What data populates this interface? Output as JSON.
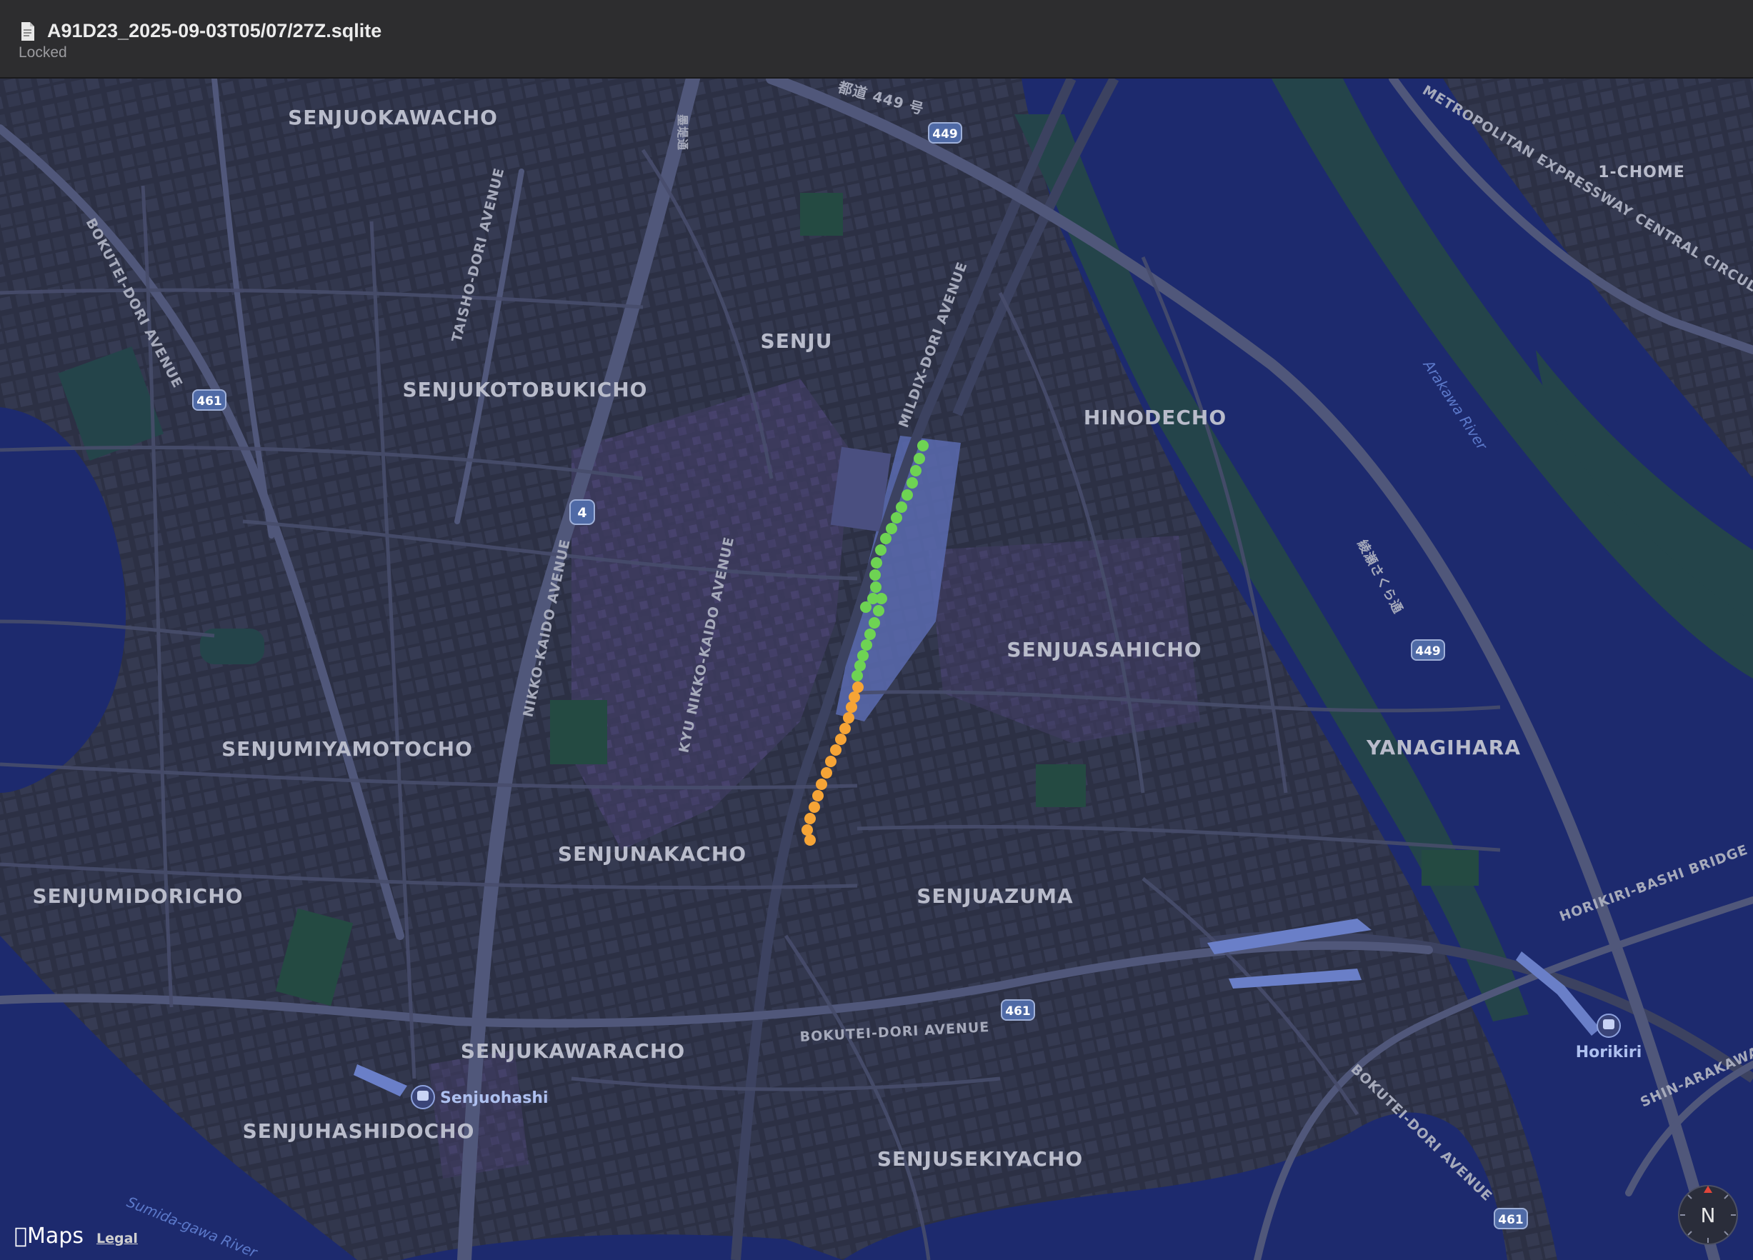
{
  "window": {
    "title": "A91D23_2025-09-03T05/07/27Z.sqlite",
    "subtitle": "Locked"
  },
  "map": {
    "districts": {
      "senjuokawacho": "SENJUOKAWACHO",
      "senju": "SENJU",
      "senjukotobukicho": "SENJUKOTOBUKICHO",
      "hinodecho": "HINODECHO",
      "one_chome": "1-CHOME",
      "senjuasahicho": "SENJUASAHICHO",
      "senjumiyamotocho": "SENJUMIYAMOTOCHO",
      "yanagihara": "YANAGIHARA",
      "senjunakacho": "SENJUNAKACHO",
      "senjumidoricho": "SENJUMIDORICHO",
      "senjuazuma": "SENJUAZUMA",
      "senjukawaracho": "SENJUKAWARACHO",
      "senjuhashidocho": "SENJUHASHIDOCHO",
      "senjusekiyacho": "SENJUSEKIYACHO"
    },
    "roads": {
      "bokutei_dori_west": "BOKUTEI-DORI AVENUE",
      "bokutei_dori_south": "BOKUTEI-DORI AVENUE",
      "bokutei_dori_southeast": "BOKUTEI-DORI AVENUE",
      "taisho_dori": "TAISHO-DORI AVENUE",
      "mildix_dori": "MILDIX-DORI AVENUE",
      "nikko_kaido": "NIKKO-KAIDO AVENUE",
      "kyu_nikko_kaido": "KYU NIKKO-KAIDO AVENUE",
      "metropolitan_expressway": "METROPOLITAN EXPRESSWAY CENTRAL CIRCULAR",
      "horikiri_bashi_bridge": "HORIKIRI-BASHI BRIDGE",
      "shin_arakawa": "SHIN-ARAKAWA",
      "route_449_jp": "都道 449 号",
      "route_449_side_jp": "綾瀬さくら通",
      "north_jp": "墨堤通"
    },
    "rivers": {
      "arakawa": "Arakawa River",
      "sumida": "Sumida-gawa River"
    },
    "stations": {
      "senjuohashi": "Senjuohashi",
      "horikiri": "Horikiri"
    },
    "route_shields": {
      "r449_top": "449",
      "r461_left": "461",
      "r4": "4",
      "r449_right": "449",
      "r461_bottom": "461",
      "r461_corner": "461"
    },
    "track": {
      "green_color": "#6ed353",
      "orange_color": "#f6a436"
    },
    "colors": {
      "water": "#1d2a6e",
      "land": "#2c3044",
      "park": "#24444a",
      "commercial": "#45406a",
      "station_area": "#5a6bb0"
    }
  },
  "attribution": {
    "maps_logo": "Maps",
    "legal": "Legal"
  },
  "compass": {
    "label": "N"
  }
}
